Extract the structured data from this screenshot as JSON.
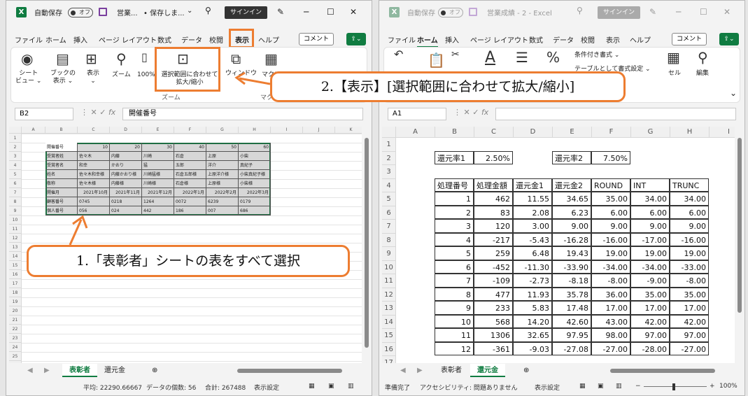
{
  "left": {
    "title": {
      "autosave": "自動保存",
      "toggle": "オフ",
      "doc": "営業...",
      "saved": "• 保存しま...",
      "signin": "サインイン"
    },
    "menu": [
      "ファイル",
      "ホーム",
      "挿入",
      "ページ レイアウト",
      "数式",
      "データ",
      "校閲",
      "表示",
      "ヘルプ"
    ],
    "active_menu": "表示",
    "comment_btn": "コメント",
    "ribbon": {
      "sheet_view": "シート\nビュー ⌄",
      "workbook_view": "ブックの\n表示 ⌄",
      "show": "表示\n⌄",
      "zoom": "ズーム",
      "zoom100": "100%",
      "zoom_to_selection": "選択範囲に合わせて\n拡大/縮小",
      "window": "ウィンドウ",
      "macro": "マクロ",
      "group_zoom": "ズーム",
      "group_macro": "マクロ"
    },
    "namebox": "B2",
    "formula": "開催番号",
    "columns": [
      "A",
      "B",
      "C",
      "D",
      "E",
      "F",
      "G",
      "H",
      "I",
      "J",
      "K"
    ],
    "grid": [
      [
        "開催番号",
        "10",
        "20",
        "30",
        "40",
        "50",
        "60"
      ],
      [
        "受賞者姓",
        "佐々木",
        "内藤",
        "川崎",
        "石倉",
        "上原",
        "小柴"
      ],
      [
        "受賞者名",
        "和幸",
        "かおり",
        "猛",
        "五郎",
        "洋介",
        "真紀子"
      ],
      [
        "姓名",
        "佐々木和幸様",
        "内藤かおり様",
        "川崎猛様",
        "石倉五郎様",
        "上原洋介様",
        "小柴真紀子様"
      ],
      [
        "敬称",
        "佐々木様",
        "内藤様",
        "川崎様",
        "石倉様",
        "上原様",
        "小柴様"
      ],
      [
        "開催月",
        "2021年10月",
        "2021年11月",
        "2021年12月",
        "2022年1月",
        "2022年2月",
        "2022年3月"
      ],
      [
        "顧客番号",
        "0745",
        "0218",
        "1264",
        "0072",
        "6239",
        "0179"
      ],
      [
        "個人番号",
        "056",
        "024",
        "442",
        "186",
        "007",
        "686"
      ]
    ],
    "tabs": [
      "表彰者",
      "還元金"
    ],
    "status": {
      "avg": "平均: 22290.66667",
      "count": "データの個数: 56",
      "sum": "合計: 267488",
      "settings": "表示設定"
    }
  },
  "right": {
    "title": {
      "autosave": "自動保存",
      "toggle": "オフ",
      "doc": "営業成績 - 2 - Excel",
      "signin": "サインイン"
    },
    "menu": [
      "ファイル",
      "ホーム",
      "挿入",
      "ページ レイアウト",
      "数式",
      "データ",
      "校閲",
      "表示",
      "ヘルプ"
    ],
    "active_menu": "ホーム",
    "comment_btn": "コメント",
    "ribbon": {
      "cond": "条件付き書式 ⌄",
      "table_fmt": "テーブルとして書式設定 ⌄",
      "cell": "セル",
      "edit": "編集"
    },
    "namebox": "A1",
    "formula": "",
    "columns": [
      "A",
      "B",
      "C",
      "D",
      "E",
      "F",
      "G",
      "H",
      "I"
    ],
    "rate1_label": "還元率1",
    "rate1": "2.50%",
    "rate2_label": "還元率2",
    "rate2": "7.50%",
    "headers": [
      "処理番号",
      "処理金額",
      "還元金1",
      "還元金2",
      "ROUND",
      "INT",
      "TRUNC"
    ],
    "rows": [
      [
        "1",
        "462",
        "11.55",
        "34.65",
        "35.00",
        "34.00",
        "34.00"
      ],
      [
        "2",
        "83",
        "2.08",
        "6.23",
        "6.00",
        "6.00",
        "6.00"
      ],
      [
        "3",
        "120",
        "3.00",
        "9.00",
        "9.00",
        "9.00",
        "9.00"
      ],
      [
        "4",
        "-217",
        "-5.43",
        "-16.28",
        "-16.00",
        "-17.00",
        "-16.00"
      ],
      [
        "5",
        "259",
        "6.48",
        "19.43",
        "19.00",
        "19.00",
        "19.00"
      ],
      [
        "6",
        "-452",
        "-11.30",
        "-33.90",
        "-34.00",
        "-34.00",
        "-33.00"
      ],
      [
        "7",
        "-109",
        "-2.73",
        "-8.18",
        "-8.00",
        "-9.00",
        "-8.00"
      ],
      [
        "8",
        "477",
        "11.93",
        "35.78",
        "36.00",
        "35.00",
        "35.00"
      ],
      [
        "9",
        "233",
        "5.83",
        "17.48",
        "17.00",
        "17.00",
        "17.00"
      ],
      [
        "10",
        "568",
        "14.20",
        "42.60",
        "43.00",
        "42.00",
        "42.00"
      ],
      [
        "11",
        "1306",
        "32.65",
        "97.95",
        "98.00",
        "97.00",
        "97.00"
      ],
      [
        "12",
        "-361",
        "-9.03",
        "-27.08",
        "-27.00",
        "-28.00",
        "-27.00"
      ]
    ],
    "tabs": [
      "表彰者",
      "還元金"
    ],
    "status": {
      "ready": "準備完了",
      "access": "アクセシビリティ: 問題ありません",
      "settings": "表示設定",
      "zoom": "100%"
    }
  },
  "callout1": "1.「表彰者」シートの表をすべて選択",
  "callout2": "2.【表示】[選択範囲に合わせて拡大/縮小]",
  "colors": {
    "accent": "#ed7d31",
    "excel_green": "#107c41"
  }
}
